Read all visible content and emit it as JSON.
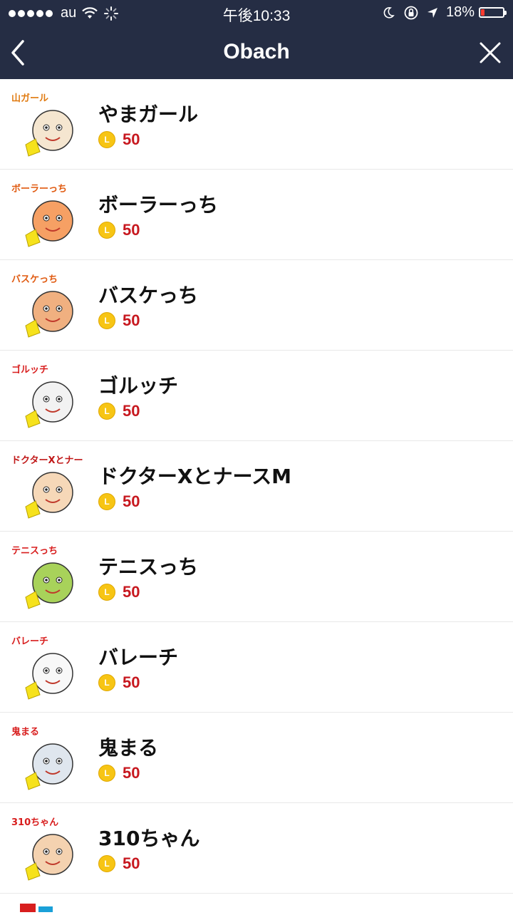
{
  "status_bar": {
    "carrier": "au",
    "time": "午後10:33",
    "battery_percent": "18%",
    "battery_level": 0.18,
    "icons": [
      "signal-icon",
      "wifi-icon",
      "loading-icon",
      "moon-icon",
      "rotation-lock-icon",
      "location-arrow-icon",
      "battery-icon"
    ]
  },
  "nav": {
    "title": "Obach",
    "back_icon": "chevron-left-icon",
    "close_icon": "close-icon"
  },
  "colors": {
    "nav_bg": "#252d44",
    "price_red": "#c7181f",
    "coin_gold": "#f7c514"
  },
  "items": [
    {
      "name": "やまガール",
      "price": "50",
      "coin_label": "L",
      "thumb_text": "山ガール",
      "thumb_color": "#e07a10",
      "face_color": "#f5e6d0"
    },
    {
      "name": "ボーラーっち",
      "price": "50",
      "coin_label": "L",
      "thumb_text": "ボーラーっち",
      "thumb_color": "#e05a10",
      "face_color": "#f6a064"
    },
    {
      "name": "バスケっち",
      "price": "50",
      "coin_label": "L",
      "thumb_text": "バスケっち",
      "thumb_color": "#e05a10",
      "face_color": "#f0b080"
    },
    {
      "name": "ゴルッチ",
      "price": "50",
      "coin_label": "L",
      "thumb_text": "ゴルッチ",
      "thumb_color": "#d81e1e",
      "face_color": "#f2f2f2"
    },
    {
      "name": "ドクターXとナースM",
      "price": "50",
      "coin_label": "L",
      "thumb_text": "ドクターXとナースM",
      "thumb_color": "#c01818",
      "face_color": "#f6d8b8"
    },
    {
      "name": "テニスっち",
      "price": "50",
      "coin_label": "L",
      "thumb_text": "テニスっち",
      "thumb_color": "#d81e1e",
      "face_color": "#a8d25a"
    },
    {
      "name": "バレーチ",
      "price": "50",
      "coin_label": "L",
      "thumb_text": "バレーチ",
      "thumb_color": "#d81e1e",
      "face_color": "#f8f8f8"
    },
    {
      "name": "鬼まる",
      "price": "50",
      "coin_label": "L",
      "thumb_text": "鬼まる",
      "thumb_color": "#d81e1e",
      "face_color": "#dfe6ee"
    },
    {
      "name": "310ちゃん",
      "price": "50",
      "coin_label": "L",
      "thumb_text": "310ちゃん",
      "thumb_color": "#d81e1e",
      "face_color": "#f4d2b0"
    }
  ]
}
